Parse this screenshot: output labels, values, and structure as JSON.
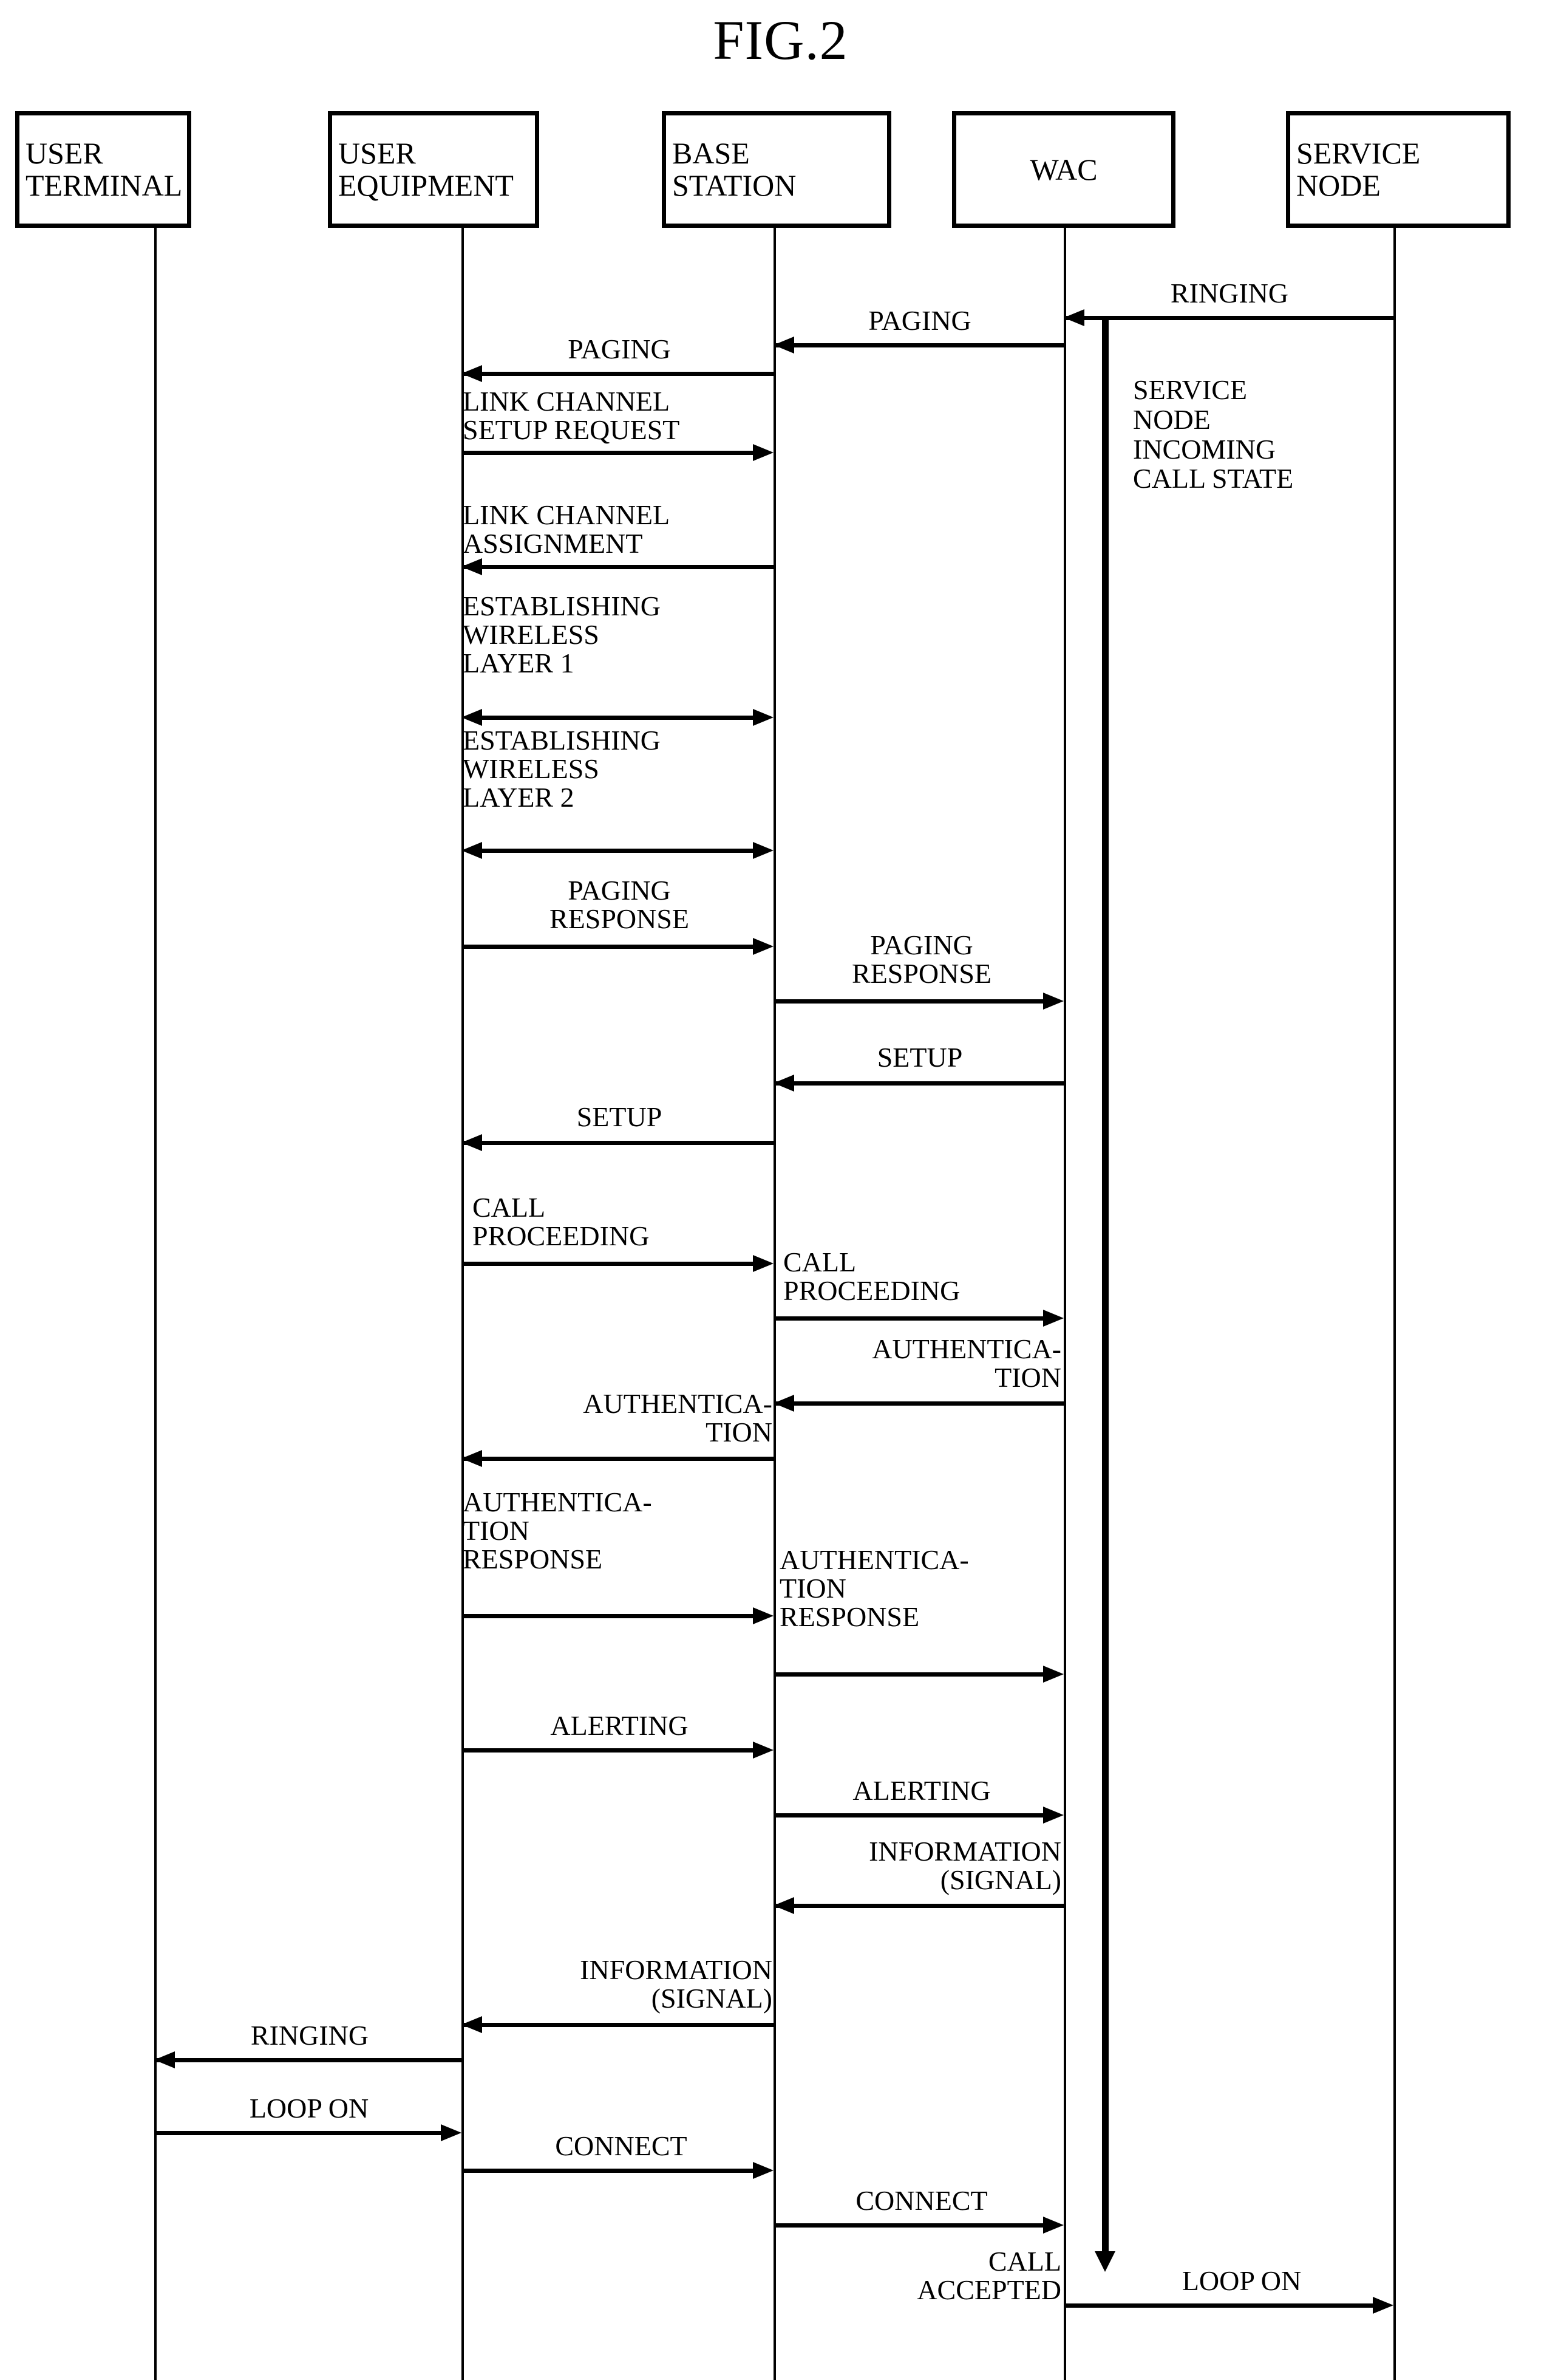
{
  "figure": {
    "title": "FIG.2",
    "type": "sequence-diagram"
  },
  "actors": [
    {
      "id": "user-terminal",
      "label": "USER\nTERMINAL"
    },
    {
      "id": "user-equipment",
      "label": "USER\nEQUIPMENT"
    },
    {
      "id": "base-station",
      "label": "BASE\nSTATION"
    },
    {
      "id": "wac",
      "label": "WAC"
    },
    {
      "id": "service-node",
      "label": "SERVICE\nNODE"
    }
  ],
  "notes": [
    {
      "id": "service-node-state",
      "text": "SERVICE\nNODE\nINCOMING\nCALL STATE"
    }
  ],
  "messages": [
    {
      "id": "m01",
      "label": "RINGING",
      "from": "service-node",
      "to": "wac",
      "direction": "left"
    },
    {
      "id": "m02",
      "label": "PAGING",
      "from": "wac",
      "to": "base-station",
      "direction": "left"
    },
    {
      "id": "m03",
      "label": "PAGING",
      "from": "base-station",
      "to": "user-equipment",
      "direction": "left"
    },
    {
      "id": "m04",
      "label": "LINK CHANNEL\nSETUP REQUEST",
      "from": "user-equipment",
      "to": "base-station",
      "direction": "right"
    },
    {
      "id": "m05",
      "label": "LINK CHANNEL\nASSIGNMENT",
      "from": "base-station",
      "to": "user-equipment",
      "direction": "left"
    },
    {
      "id": "m06",
      "label": "ESTABLISHING\nWIRELESS\nLAYER 1",
      "from": "user-equipment",
      "to": "base-station",
      "direction": "both"
    },
    {
      "id": "m07",
      "label": "ESTABLISHING\nWIRELESS\nLAYER 2",
      "from": "user-equipment",
      "to": "base-station",
      "direction": "both"
    },
    {
      "id": "m08",
      "label": "PAGING\nRESPONSE",
      "from": "user-equipment",
      "to": "base-station",
      "direction": "right"
    },
    {
      "id": "m09",
      "label": "PAGING\nRESPONSE",
      "from": "base-station",
      "to": "wac",
      "direction": "right"
    },
    {
      "id": "m10",
      "label": "SETUP",
      "from": "wac",
      "to": "base-station",
      "direction": "left"
    },
    {
      "id": "m11",
      "label": "SETUP",
      "from": "base-station",
      "to": "user-equipment",
      "direction": "left"
    },
    {
      "id": "m12",
      "label": "CALL\nPROCEEDING",
      "from": "user-equipment",
      "to": "base-station",
      "direction": "right"
    },
    {
      "id": "m13",
      "label": "CALL\nPROCEEDING",
      "from": "base-station",
      "to": "wac",
      "direction": "right"
    },
    {
      "id": "m14",
      "label": "AUTHENTICA-\nTION",
      "from": "wac",
      "to": "base-station",
      "direction": "left"
    },
    {
      "id": "m15",
      "label": "AUTHENTICA-\nTION",
      "from": "base-station",
      "to": "user-equipment",
      "direction": "left"
    },
    {
      "id": "m16",
      "label": "AUTHENTICA-\nTION\nRESPONSE",
      "from": "user-equipment",
      "to": "base-station",
      "direction": "right"
    },
    {
      "id": "m17",
      "label": "AUTHENTICA-\nTION\nRESPONSE",
      "from": "base-station",
      "to": "wac",
      "direction": "right"
    },
    {
      "id": "m18",
      "label": "ALERTING",
      "from": "user-equipment",
      "to": "base-station",
      "direction": "right"
    },
    {
      "id": "m19",
      "label": "ALERTING",
      "from": "base-station",
      "to": "wac",
      "direction": "right"
    },
    {
      "id": "m20",
      "label": "INFORMATION\n(SIGNAL)",
      "from": "wac",
      "to": "base-station",
      "direction": "left"
    },
    {
      "id": "m21",
      "label": "INFORMATION\n(SIGNAL)",
      "from": "base-station",
      "to": "user-equipment",
      "direction": "left"
    },
    {
      "id": "m22",
      "label": "RINGING",
      "from": "user-equipment",
      "to": "user-terminal",
      "direction": "left"
    },
    {
      "id": "m23",
      "label": "LOOP ON",
      "from": "user-terminal",
      "to": "user-equipment",
      "direction": "right"
    },
    {
      "id": "m24",
      "label": "CONNECT",
      "from": "user-equipment",
      "to": "base-station",
      "direction": "right"
    },
    {
      "id": "m25",
      "label": "CONNECT",
      "from": "base-station",
      "to": "wac",
      "direction": "right"
    },
    {
      "id": "m26",
      "label": "CALL\nACCEPTED",
      "from": "base-station",
      "to": "wac",
      "direction": "none"
    },
    {
      "id": "m27",
      "label": "LOOP ON",
      "from": "wac",
      "to": "service-node",
      "direction": "right"
    }
  ]
}
